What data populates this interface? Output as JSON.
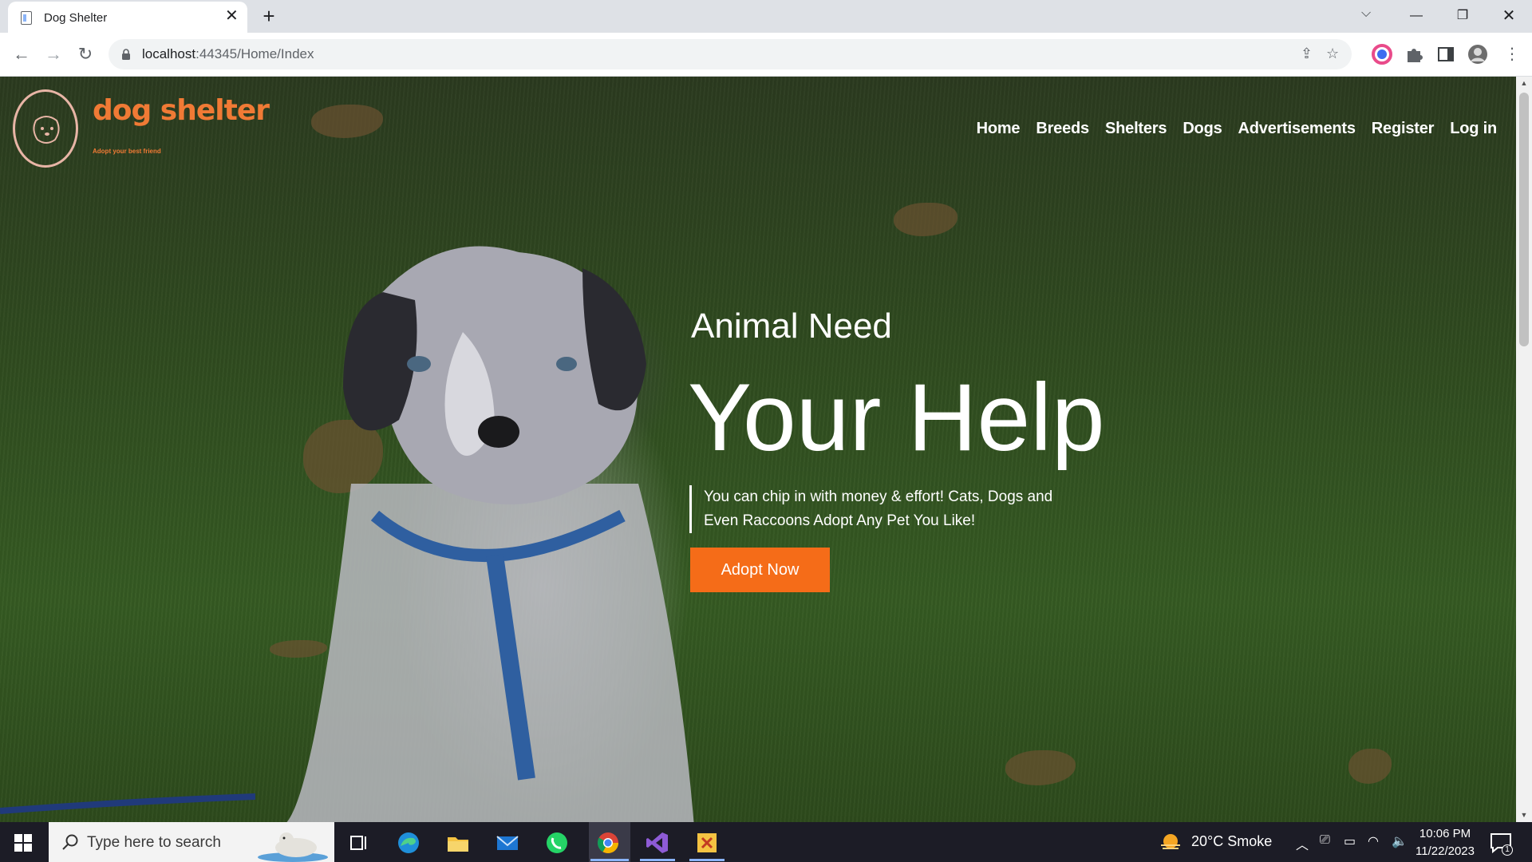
{
  "browser": {
    "tab_title": "Dog Shelter",
    "tab_close": "✕",
    "new_tab": "+",
    "url_host": "localhost",
    "url_path": ":44345/Home/Index"
  },
  "site": {
    "logo_text": "dog shelter",
    "logo_tagline": "Adopt your best friend",
    "nav": [
      "Home",
      "Breeds",
      "Shelters",
      "Dogs",
      "Advertisements",
      "Register",
      "Log in"
    ],
    "hero": {
      "kicker": "Animal Need",
      "title": "Your Help",
      "subtitle": "You can chip in with money & effort! Cats, Dogs and Even Raccoons Adopt Any Pet You Like!",
      "cta": "Adopt Now"
    }
  },
  "taskbar": {
    "search_placeholder": "Type here to search",
    "weather": "20°C  Smoke",
    "time": "10:06 PM",
    "date": "11/22/2023",
    "notification_count": "1"
  },
  "colors": {
    "accent": "#f56c18",
    "logo": "#f07a35"
  }
}
